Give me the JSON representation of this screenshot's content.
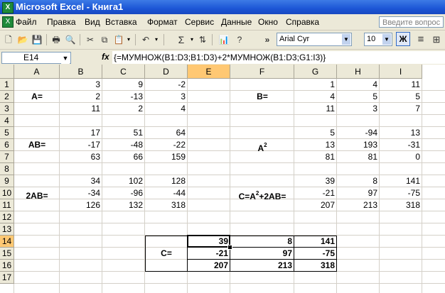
{
  "window": {
    "title": "Microsoft Excel - Книга1",
    "app_icon": "X"
  },
  "menu": [
    "Файл",
    "Правка",
    "Вид",
    "Вставка",
    "Формат",
    "Сервис",
    "Данные",
    "Окно",
    "Справка"
  ],
  "help_box": {
    "placeholder": "Введите вопрос"
  },
  "toolbar": {
    "font": "Arial Cyr",
    "size": "10",
    "bold_label": "Ж",
    "sum_label": "Σ",
    "chevron": "»"
  },
  "formula_bar": {
    "name_box": "E14",
    "fx_label": "fx",
    "formula": "{=МУМНОЖ(B1:D3;B1:D3)+2*МУМНОЖ(B1:D3;G1:I3)}"
  },
  "columns": [
    "A",
    "B",
    "C",
    "D",
    "E",
    "F",
    "G",
    "H",
    "I"
  ],
  "rows": [
    "1",
    "2",
    "3",
    "4",
    "5",
    "6",
    "7",
    "8",
    "9",
    "10",
    "11",
    "12",
    "13",
    "14",
    "15",
    "16",
    "17"
  ],
  "active_cell": {
    "column": "E",
    "row": "14"
  },
  "labels": {
    "A": "A=",
    "B": "B=",
    "AB": "AB=",
    "A2_base": "A",
    "A2_exp": "2",
    "twoAB": "2AB=",
    "C_prefix": "C=A",
    "C_exp": "2",
    "C_suffix": "+2AB=",
    "C_result": "C="
  },
  "matrices": {
    "A": [
      [
        "3",
        "9",
        "-2"
      ],
      [
        "2",
        "-13",
        "3"
      ],
      [
        "11",
        "2",
        "4"
      ]
    ],
    "B": [
      [
        "1",
        "4",
        "11"
      ],
      [
        "4",
        "5",
        "5"
      ],
      [
        "11",
        "3",
        "7"
      ]
    ],
    "AB": [
      [
        "17",
        "51",
        "64"
      ],
      [
        "-17",
        "-48",
        "-22"
      ],
      [
        "63",
        "66",
        "159"
      ]
    ],
    "A2": [
      [
        "5",
        "-94",
        "13"
      ],
      [
        "13",
        "193",
        "-31"
      ],
      [
        "81",
        "81",
        "0"
      ]
    ],
    "twoAB": [
      [
        "34",
        "102",
        "128"
      ],
      [
        "-34",
        "-96",
        "-44"
      ],
      [
        "126",
        "132",
        "318"
      ]
    ],
    "C": [
      [
        "39",
        "8",
        "141"
      ],
      [
        "-21",
        "97",
        "-75"
      ],
      [
        "207",
        "213",
        "318"
      ]
    ],
    "C_result": [
      [
        "39",
        "8",
        "141"
      ],
      [
        "-21",
        "97",
        "-75"
      ],
      [
        "207",
        "213",
        "318"
      ]
    ]
  }
}
